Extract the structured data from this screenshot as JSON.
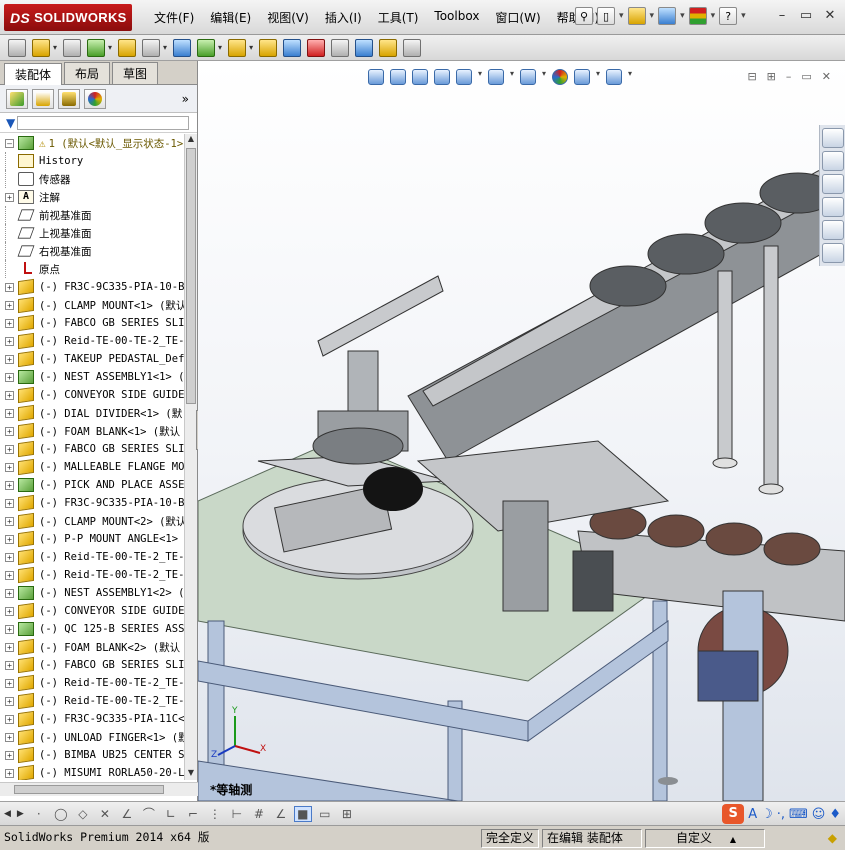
{
  "app": {
    "logo_prefix": "DS",
    "logo": "SOLIDWORKS"
  },
  "menu": [
    "文件(F)",
    "编辑(E)",
    "视图(V)",
    "插入(I)",
    "工具(T)",
    "Toolbox",
    "窗口(W)",
    "帮助(H)"
  ],
  "window_controls": {
    "minimize": "–",
    "restore": "▭",
    "close": "✕"
  },
  "feature_manager": {
    "tabs": [
      "装配体",
      "布局",
      "草图"
    ],
    "active_tab": "装配体",
    "more": "»",
    "filter_icon": "filter-icon",
    "root": {
      "warning": "⚠",
      "label": "1  (默认<默认_显示状态-1>)"
    },
    "fixed_items": [
      {
        "label": "History",
        "icon": "history-icon"
      },
      {
        "label": "传感器",
        "icon": "sensor-icon"
      },
      {
        "label": "注解",
        "icon": "annotation-icon",
        "expandable": true
      },
      {
        "label": "前视基准面",
        "icon": "plane-icon"
      },
      {
        "label": "上视基准面",
        "icon": "plane-icon"
      },
      {
        "label": "右视基准面",
        "icon": "plane-icon"
      },
      {
        "label": "原点",
        "icon": "origin-icon"
      }
    ],
    "components": [
      {
        "label": "(-) FR3C-9C335-PIA-10-B",
        "kind": "part"
      },
      {
        "label": "(-) CLAMP MOUNT<1> (默认",
        "kind": "part"
      },
      {
        "label": "(-) FABCO GB SERIES SLI",
        "kind": "part"
      },
      {
        "label": "(-) Reid-TE-00-TE-2_TE-",
        "kind": "part"
      },
      {
        "label": "(-) TAKEUP PEDASTAL_Def",
        "kind": "part"
      },
      {
        "label": "(-) NEST ASSEMBLY1<1> (",
        "kind": "asm"
      },
      {
        "label": "(-) CONVEYOR SIDE GUIDE",
        "kind": "part"
      },
      {
        "label": "(-) DIAL DIVIDER<1> (默",
        "kind": "part"
      },
      {
        "label": "(-) FOAM BLANK<1> (默认",
        "kind": "part"
      },
      {
        "label": "(-) FABCO GB SERIES SLI",
        "kind": "part"
      },
      {
        "label": "(-) MALLEABLE FLANGE MO",
        "kind": "part"
      },
      {
        "label": "(-) PICK AND PLACE ASSE",
        "kind": "asm"
      },
      {
        "label": "(-) FR3C-9C335-PIA-10-B",
        "kind": "part"
      },
      {
        "label": "(-) CLAMP MOUNT<2> (默认",
        "kind": "part"
      },
      {
        "label": "(-) P-P MOUNT ANGLE<1>",
        "kind": "part"
      },
      {
        "label": "(-) Reid-TE-00-TE-2_TE-",
        "kind": "part"
      },
      {
        "label": "(-) Reid-TE-00-TE-2_TE-",
        "kind": "part"
      },
      {
        "label": "(-) NEST ASSEMBLY1<2> (",
        "kind": "asm"
      },
      {
        "label": "(-) CONVEYOR SIDE GUIDE",
        "kind": "part"
      },
      {
        "label": "(-) QC 125-B SERIES ASS",
        "kind": "asm"
      },
      {
        "label": "(-) FOAM BLANK<2> (默认",
        "kind": "part"
      },
      {
        "label": "(-) FABCO GB SERIES SLI",
        "kind": "part"
      },
      {
        "label": "(-) Reid-TE-00-TE-2_TE-",
        "kind": "part"
      },
      {
        "label": "(-) Reid-TE-00-TE-2_TE-",
        "kind": "part"
      },
      {
        "label": "(-) FR3C-9C335-PIA-11C<",
        "kind": "part"
      },
      {
        "label": "(-) UNLOAD FINGER<1> (默",
        "kind": "part"
      },
      {
        "label": "(-) BIMBA UB25 CENTER S",
        "kind": "part"
      },
      {
        "label": "(-) MISUMI RORLA50-20-L",
        "kind": "part"
      }
    ]
  },
  "graphics": {
    "view_name": "*等轴测",
    "triad": {
      "x": "X",
      "y": "Y",
      "z": "Z"
    }
  },
  "ime": {
    "logo": "S",
    "mode": "A"
  },
  "status_bar": {
    "product": "SolidWorks Premium 2014 x64 版",
    "definition": "完全定义",
    "edit_state": "在编辑 装配体",
    "units": "自定义",
    "units_arrow": "▲"
  },
  "colors": {
    "logo_red": "#b3131b",
    "table_top": "#c9d8c8",
    "frame_blue": "#b4c4dc",
    "steel": "#a0a4a8"
  }
}
